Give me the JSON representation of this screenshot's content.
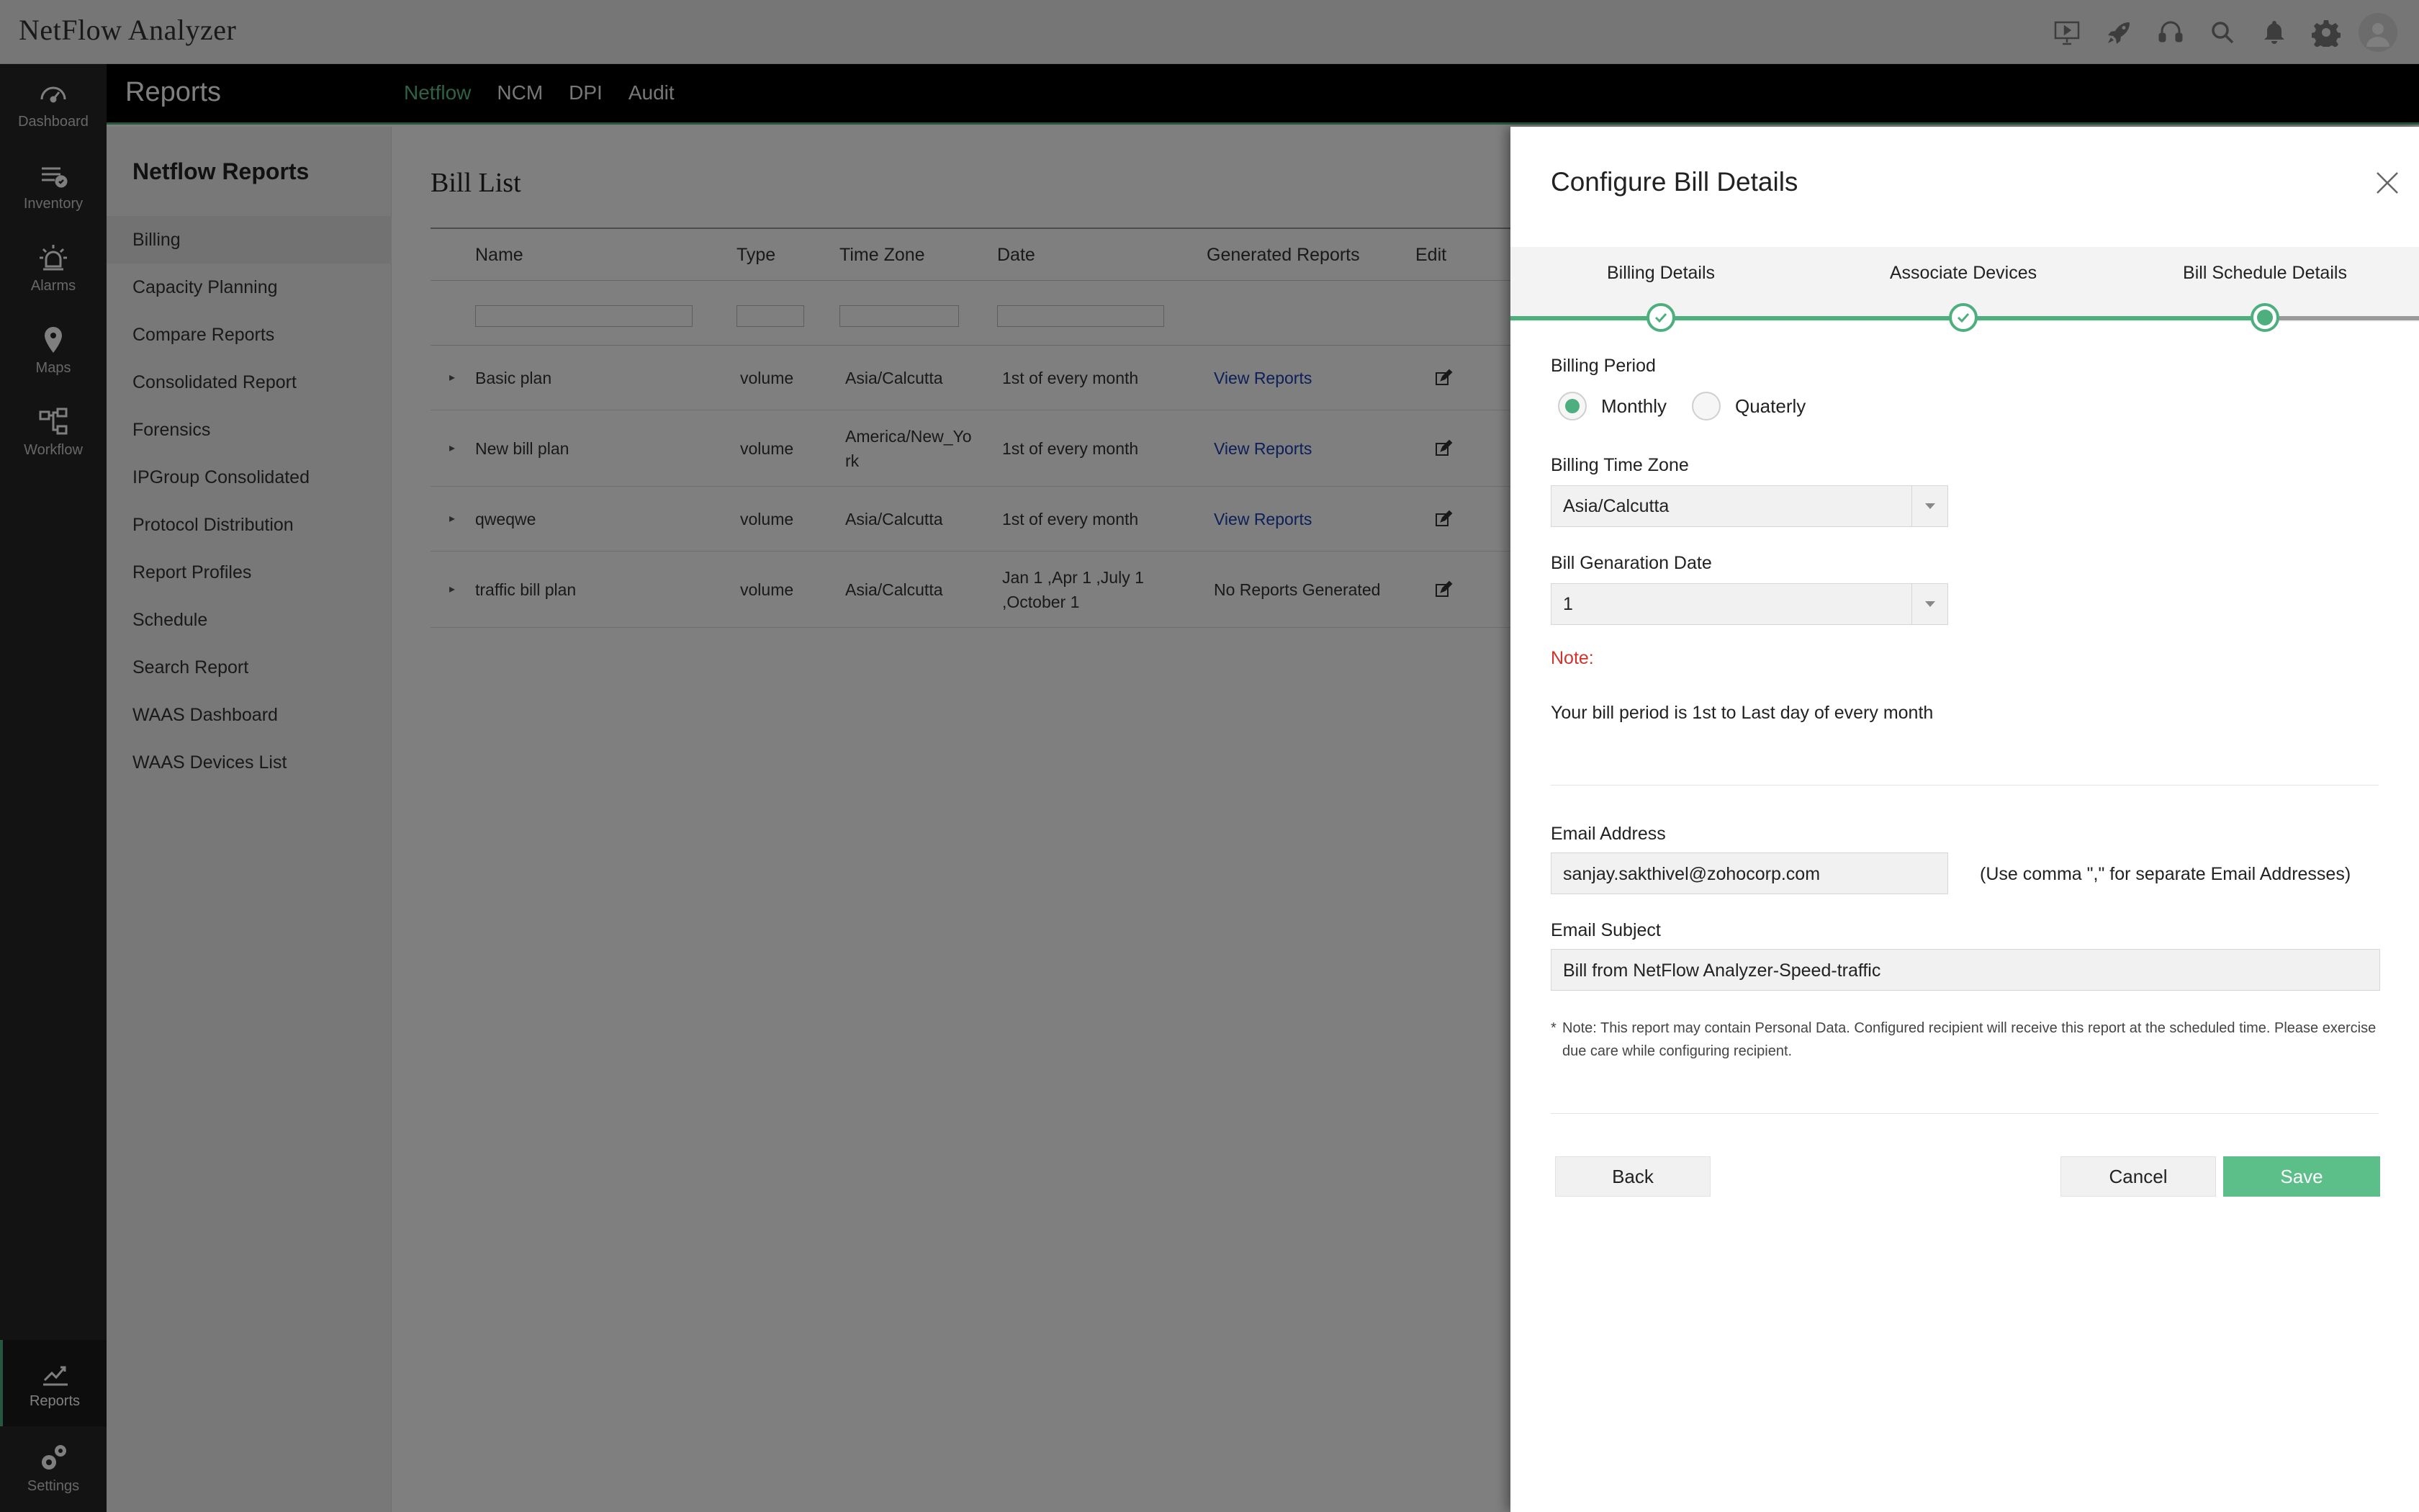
{
  "app": {
    "title": "NetFlow Analyzer"
  },
  "left_nav": [
    {
      "label": "Dashboard",
      "icon": "dashboard-icon"
    },
    {
      "label": "Inventory",
      "icon": "inventory-icon"
    },
    {
      "label": "Alarms",
      "icon": "alarms-icon"
    },
    {
      "label": "Maps",
      "icon": "map-pin-icon"
    },
    {
      "label": "Workflow",
      "icon": "workflow-icon"
    },
    {
      "label": "Reports",
      "icon": "reports-icon",
      "active": true
    },
    {
      "label": "Settings",
      "icon": "settings-gears-icon"
    }
  ],
  "module": {
    "title": "Reports",
    "tabs": [
      "Netflow",
      "NCM",
      "DPI",
      "Audit"
    ],
    "active_tab": "Netflow"
  },
  "subnav": {
    "title": "Netflow Reports",
    "items": [
      "Billing",
      "Capacity Planning",
      "Compare Reports",
      "Consolidated Report",
      "Forensics",
      "IPGroup Consolidated",
      "Protocol Distribution",
      "Report Profiles",
      "Schedule",
      "Search Report",
      "WAAS Dashboard",
      "WAAS Devices List"
    ],
    "active": "Billing"
  },
  "bill_list": {
    "title": "Bill List",
    "columns": [
      "Name",
      "Type",
      "Time Zone",
      "Date",
      "Generated Reports",
      "Edit"
    ],
    "rows": [
      {
        "name": "Basic plan",
        "type": "volume",
        "time_zone": "Asia/Calcutta",
        "date": "1st of every month",
        "reports": "View Reports"
      },
      {
        "name": "New bill plan",
        "type": "volume",
        "time_zone": "America/New_York",
        "time_zone_l1": "America/New_Yo",
        "time_zone_l2": "rk",
        "date": "1st of every month",
        "reports": "View Reports"
      },
      {
        "name": "qweqwe",
        "type": "volume",
        "time_zone": "Asia/Calcutta",
        "date": "1st of every month",
        "reports": "View Reports"
      },
      {
        "name": "traffic bill plan",
        "type": "volume",
        "time_zone": "Asia/Calcutta",
        "date_l1": "Jan 1 ,Apr 1 ,July 1",
        "date_l2": ",October 1",
        "reports": "No Reports Generated"
      }
    ]
  },
  "drawer": {
    "title": "Configure Bill Details",
    "steps": [
      {
        "label": "Billing Details",
        "state": "done"
      },
      {
        "label": "Associate Devices",
        "state": "done"
      },
      {
        "label": "Bill Schedule Details",
        "state": "current"
      }
    ],
    "billing_period": {
      "label": "Billing Period",
      "options": [
        "Monthly",
        "Quaterly"
      ],
      "selected": "Monthly"
    },
    "time_zone": {
      "label": "Billing Time Zone",
      "value": "Asia/Calcutta"
    },
    "generation_date": {
      "label": "Bill Genaration Date",
      "value": "1"
    },
    "note_label": "Note:",
    "note_text": "Your bill period is 1st to Last day of every month",
    "email": {
      "label": "Email Address",
      "value": "sanjay.sakthivel@zohocorp.com",
      "hint": "(Use comma \",\" for separate Email Addresses)"
    },
    "subject": {
      "label": "Email Subject",
      "value": "Bill from NetFlow Analyzer-Speed-traffic"
    },
    "privacy_note_star": "*",
    "privacy_note": "Note: This report may contain Personal Data. Configured recipient will receive this report at the scheduled time. Please exercise due care while configuring recipient.",
    "buttons": {
      "back": "Back",
      "cancel": "Cancel",
      "save": "Save"
    }
  },
  "colors": {
    "accent": "#4caf7d",
    "link": "#1a3fb3",
    "note": "#d0342c",
    "save": "#5cbf8a"
  }
}
